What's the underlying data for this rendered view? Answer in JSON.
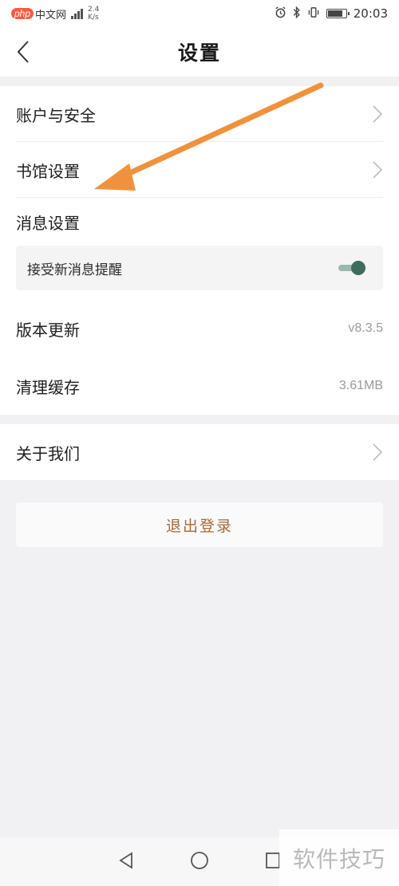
{
  "status_bar": {
    "logo_php": "php",
    "logo_cn": "中文网",
    "speed_value": "2.4",
    "speed_unit": "K/s",
    "time": "20:03"
  },
  "nav": {
    "title": "设置"
  },
  "groups": {
    "account": {
      "label": "账户与安全"
    },
    "library": {
      "label": "书馆设置"
    },
    "messages": {
      "label": "消息设置",
      "sub_label": "接受新消息提醒",
      "enabled": true
    },
    "version": {
      "label": "版本更新",
      "value": "v8.3.5"
    },
    "cache": {
      "label": "清理缓存",
      "value": "3.61MB"
    },
    "about": {
      "label": "关于我们"
    }
  },
  "logout": {
    "label": "退出登录"
  },
  "watermark": {
    "text": "软件技巧"
  },
  "colors": {
    "accent": "#a8683a",
    "toggle_on": "#3e6c5d",
    "annotation_arrow": "#f0923b"
  },
  "icons": {
    "back": "chevron-left-icon",
    "row_arrow": "chevron-right-icon",
    "nav_back": "triangle-back-icon",
    "nav_home": "circle-home-icon",
    "nav_recent": "square-recent-icon"
  }
}
